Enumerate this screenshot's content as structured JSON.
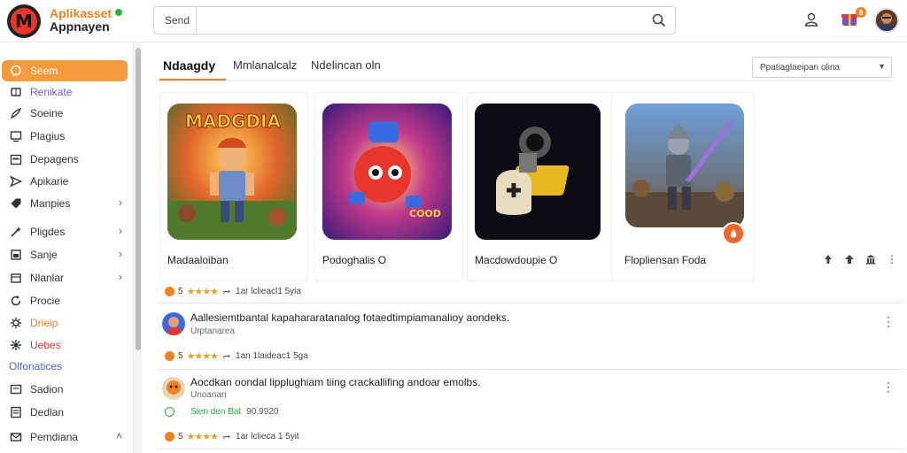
{
  "header": {
    "brand_line1": "Aplikasset",
    "brand_line2": "Appnayen",
    "logo_letter": "M",
    "search_label": "Send",
    "search_value": "",
    "gift_badge": "8",
    "accent": "#f0821e"
  },
  "sidebar": {
    "items": [
      {
        "label": "Seem",
        "icon": "chat-icon"
      },
      {
        "label": "Renikate",
        "icon": "ticket-icon"
      },
      {
        "label": "Soeine",
        "icon": "brush-icon"
      },
      {
        "label": "Plagius",
        "icon": "monitor-icon"
      },
      {
        "label": "Depagens",
        "icon": "calendar-icon"
      },
      {
        "label": "Apikarie",
        "icon": "send-icon"
      },
      {
        "label": "Manpies",
        "icon": "tag-icon"
      },
      {
        "label": "Pligdes",
        "icon": "magic-icon"
      },
      {
        "label": "Sanje",
        "icon": "square-icon"
      },
      {
        "label": "Nlanlar",
        "icon": "box-icon"
      },
      {
        "label": "Procie",
        "icon": "refresh-icon"
      },
      {
        "label": "Drieip",
        "icon": "gear-icon"
      },
      {
        "label": "Uebes",
        "icon": "settings-icon"
      },
      {
        "label": "Olfonatices",
        "icon": ""
      },
      {
        "label": "Sadion",
        "icon": "screen-icon"
      },
      {
        "label": "Dedlan",
        "icon": "doc-icon"
      },
      {
        "label": "Pemdiana",
        "icon": "mail-icon"
      }
    ]
  },
  "tabs": [
    {
      "label": "Ndaagdy"
    },
    {
      "label": "Mmlanalcalz"
    },
    {
      "label": "Ndelincan oln"
    }
  ],
  "sort_select": {
    "value": "Ppatiaglaeipan olina"
  },
  "cards": [
    {
      "name": "Madaaloiban",
      "art_title": "MADGDIA",
      "icon": "game-hero-art"
    },
    {
      "name": "Podoghalis O",
      "art_title": "COOD",
      "icon": "game-robot-art"
    },
    {
      "name": "Macdowdoupie O",
      "art_title": "",
      "icon": "game-bag-art"
    },
    {
      "name": "Flopliensan Foda",
      "art_title": "",
      "icon": "game-knight-art"
    }
  ],
  "card_tools": [
    "arrow-up-icon",
    "pin-icon",
    "bank-icon",
    "more-icon"
  ],
  "meta_rows": [
    {
      "num": "5",
      "share": "1ar lclieacl1 5yia",
      "stars": "★★★★"
    },
    {
      "num": "5",
      "share": "1an 1laideac1 5ga",
      "stars": "★★★★"
    },
    {
      "num": "5",
      "share": "1ar lclieca 1 5yit",
      "stars": "★★★★"
    }
  ],
  "posts": [
    {
      "text": "Aallesiemtbantal kapahararatanalog fotaedtimpiamanalioy aondeks.",
      "sub": "Urptanarea"
    },
    {
      "text": "Aocdkan oondal lipplughiam tiing crackallifing andoar emolbs.",
      "sub": "Unoanan"
    }
  ],
  "status": {
    "label": "Sien den Bat",
    "value": "90.9920"
  }
}
